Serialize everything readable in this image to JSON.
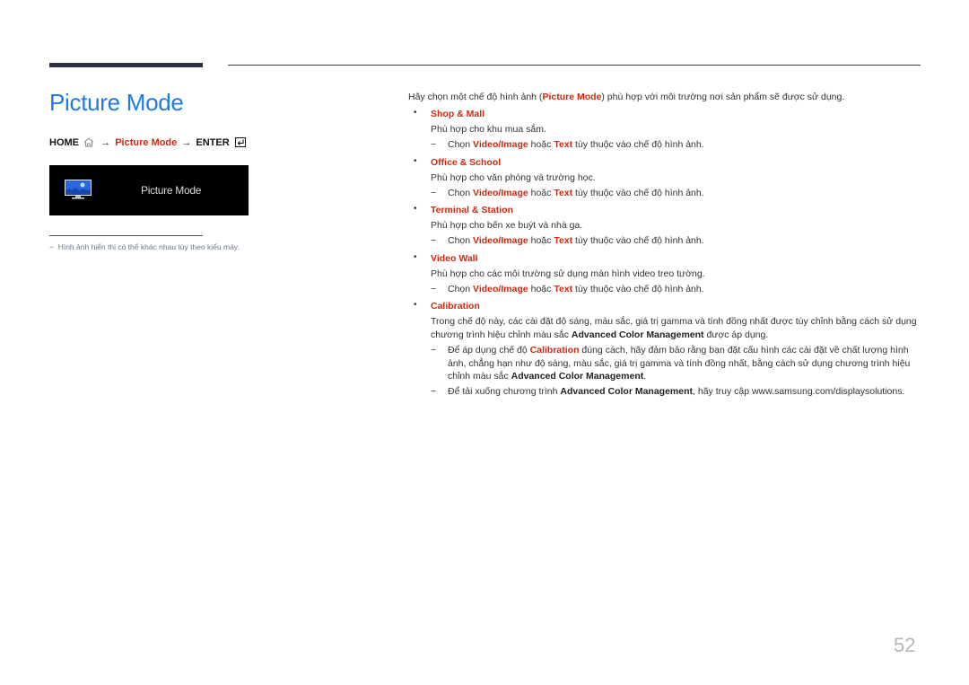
{
  "header": {
    "title": "Picture Mode"
  },
  "nav_path": {
    "home": "HOME",
    "arrow": "→",
    "menu": "Picture Mode",
    "enter": "ENTER"
  },
  "osd": {
    "label": "Picture Mode",
    "icon": "monitor-picture-icon"
  },
  "note": {
    "dash": "−",
    "text": "Hình ảnh hiển thị có thể khác nhau tùy theo kiểu máy."
  },
  "content": {
    "intro_before": "Hãy chọn một chế độ hình ảnh (",
    "intro_hl": "Picture Mode",
    "intro_after": ") phù hợp với môi trường nơi sản phẩm sẽ được sử dụng.",
    "bullet": "•",
    "dash": "−",
    "items": [
      {
        "name": "Shop & Mall",
        "desc": "Phù hợp cho khu mua sắm.",
        "sub": {
          "a": "Chọn ",
          "b": "Video/Image",
          "c": " hoặc ",
          "d": "Text",
          "e": " tùy thuộc vào chế độ hình ảnh."
        }
      },
      {
        "name": "Office & School",
        "desc": "Phù hợp cho văn phòng và trường học.",
        "sub": {
          "a": "Chọn ",
          "b": "Video/Image",
          "c": " hoặc ",
          "d": "Text",
          "e": " tùy thuộc vào chế độ hình ảnh."
        }
      },
      {
        "name": "Terminal & Station",
        "desc": "Phù hợp cho bến xe buýt và nhà ga.",
        "sub": {
          "a": "Chọn ",
          "b": "Video/Image",
          "c": " hoặc ",
          "d": "Text",
          "e": " tùy thuộc vào chế độ hình ảnh."
        }
      },
      {
        "name": "Video Wall",
        "desc": "Phù hợp cho các môi trường sử dụng màn hình video treo tường.",
        "sub": {
          "a": "Chọn ",
          "b": "Video/Image",
          "c": " hoặc ",
          "d": "Text",
          "e": " tùy thuộc vào chế độ hình ảnh."
        }
      }
    ],
    "calibration": {
      "name": "Calibration",
      "desc_a": "Trong chế độ này, các cài đặt độ sáng, màu sắc, giá trị gamma và tính đồng nhất được tùy chỉnh bằng cách sử dụng chương trình hiệu chỉnh màu sắc ",
      "desc_b": "Advanced Color Management",
      "desc_c": " được áp dụng.",
      "sub1_a": "Để áp dụng chế độ ",
      "sub1_b": "Calibration",
      "sub1_c": " đúng cách, hãy đảm bảo rằng bạn đặt cấu hình các cài đặt về chất lượng hình ảnh, chẳng hạn như độ sáng, màu sắc, giá trị gamma và tính đồng nhất, bằng cách sử dụng chương trình hiệu chỉnh màu sắc ",
      "sub1_d": "Advanced Color Management",
      "sub1_e": ".",
      "sub2_a": "Để tải xuống chương trình ",
      "sub2_b": "Advanced Color Management",
      "sub2_c": ", hãy truy cập www.samsung.com/displaysolutions."
    }
  },
  "page_number": "52",
  "colors": {
    "title": "#1e7be6",
    "highlight": "#cc2a10",
    "osd_bg": "#000000"
  }
}
